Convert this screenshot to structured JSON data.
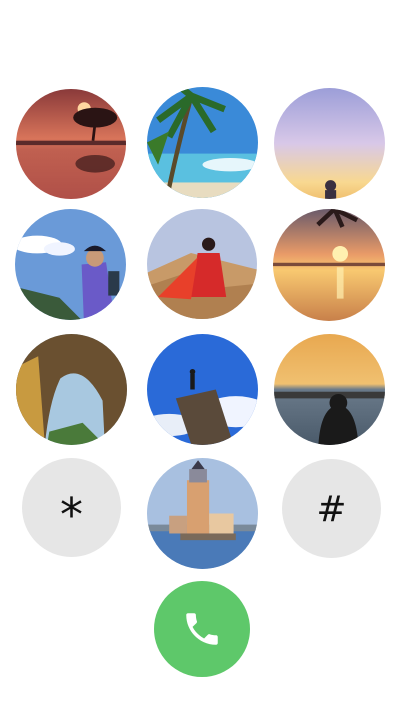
{
  "keypad": {
    "rows": [
      [
        {
          "photo": "lone-tree-sunset"
        },
        {
          "photo": "palm-beach"
        },
        {
          "photo": "pastel-sky-sunset"
        }
      ],
      [
        {
          "photo": "hiker-on-mountain"
        },
        {
          "photo": "woman-red-dress-desert"
        },
        {
          "photo": "sea-sunset-palm"
        }
      ],
      [
        {
          "photo": "rock-arch"
        },
        {
          "photo": "person-on-cliff"
        },
        {
          "photo": "woman-at-sea-dusk"
        }
      ],
      [
        {
          "symbol": "*"
        },
        {
          "photo": "lighthouse-tower"
        },
        {
          "symbol": "#"
        }
      ]
    ]
  },
  "call_button": {
    "icon": "phone-icon",
    "color": "#5ec86a"
  }
}
